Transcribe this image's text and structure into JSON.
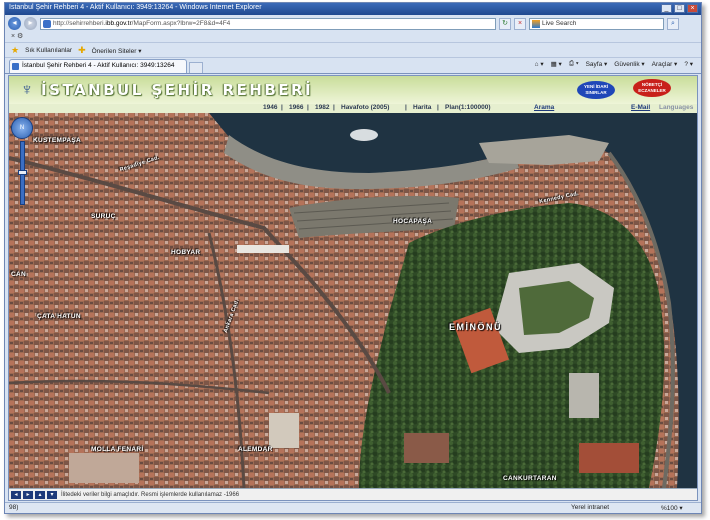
{
  "window": {
    "title": "İstanbul Şehir Rehberi 4 - Aktif Kullanıcı: 3949:13264 - Windows Internet Explorer",
    "controls": [
      "_",
      "□",
      "×"
    ]
  },
  "addressbar": {
    "url_prefix": "http://sehirrehberi.",
    "url_host": "ibb.gov.tr",
    "url_rest": "/MapForm.aspx?lbrw=2F8&d=4F4",
    "search_placeholder": "Live Search"
  },
  "menu": {
    "label": "× ⚙"
  },
  "favorites": {
    "items": [
      "Sık Kullanılanlar",
      "Önerilen Siteler ▾"
    ]
  },
  "tab": {
    "label": "İstanbul Şehir Rehberi 4 - Aktif Kullanıcı: 3949:13264"
  },
  "commandbar": {
    "items": [
      "Sayfa ▾",
      "Güvenlik ▾",
      "Araçlar ▾",
      "? ▾"
    ]
  },
  "page": {
    "logo_text": "İSTANBUL ŞEHİR REHBERİ",
    "badge_blue": "YENİ İDARİ SINIRLAR",
    "badge_red": "NÖBETÇİ ECZANELER",
    "nav": {
      "layers": [
        "1946",
        "1966",
        "1982",
        "Havafoto (2005)",
        "Harita",
        "Plan(1:100000)"
      ],
      "separator": "|",
      "search": "Arama",
      "email": "E-Mail",
      "languages": "Languages"
    },
    "map_labels": {
      "kuztepasa": "KUSTEMPAŞA",
      "suruc": "SURUÇ",
      "hobyar": "HOBYAR",
      "hocapasa": "HOCAPAŞA",
      "eminonu": "EMİNÖNÜ",
      "can": "CAN",
      "catha": "ÇATA HATUN",
      "molla": "MOLLA FENARİ",
      "alemdar": "ALEMDAR",
      "cankurtaran": "CANKURTARAN",
      "road_kennedy": "Kennedy Cad.",
      "road_ragip": "Reşadiye Cad.",
      "road_ankara": "Ankara Cad."
    },
    "zoom_label": "N",
    "disclaimer": "İlitedeki veriler bilgi amaçlıdır. Resmi işlemlerde kullanılamaz -1966",
    "map_buttons": [
      "◂",
      "▸",
      "▴",
      "▾"
    ]
  },
  "statusbar": {
    "left": "98)",
    "zone": "Yerel intranet",
    "zoom": "%100 ▾"
  },
  "colors": {
    "banner": "#c9dd9a",
    "nav_link": "#1e3a7a",
    "frame": "#d8e3f2"
  }
}
